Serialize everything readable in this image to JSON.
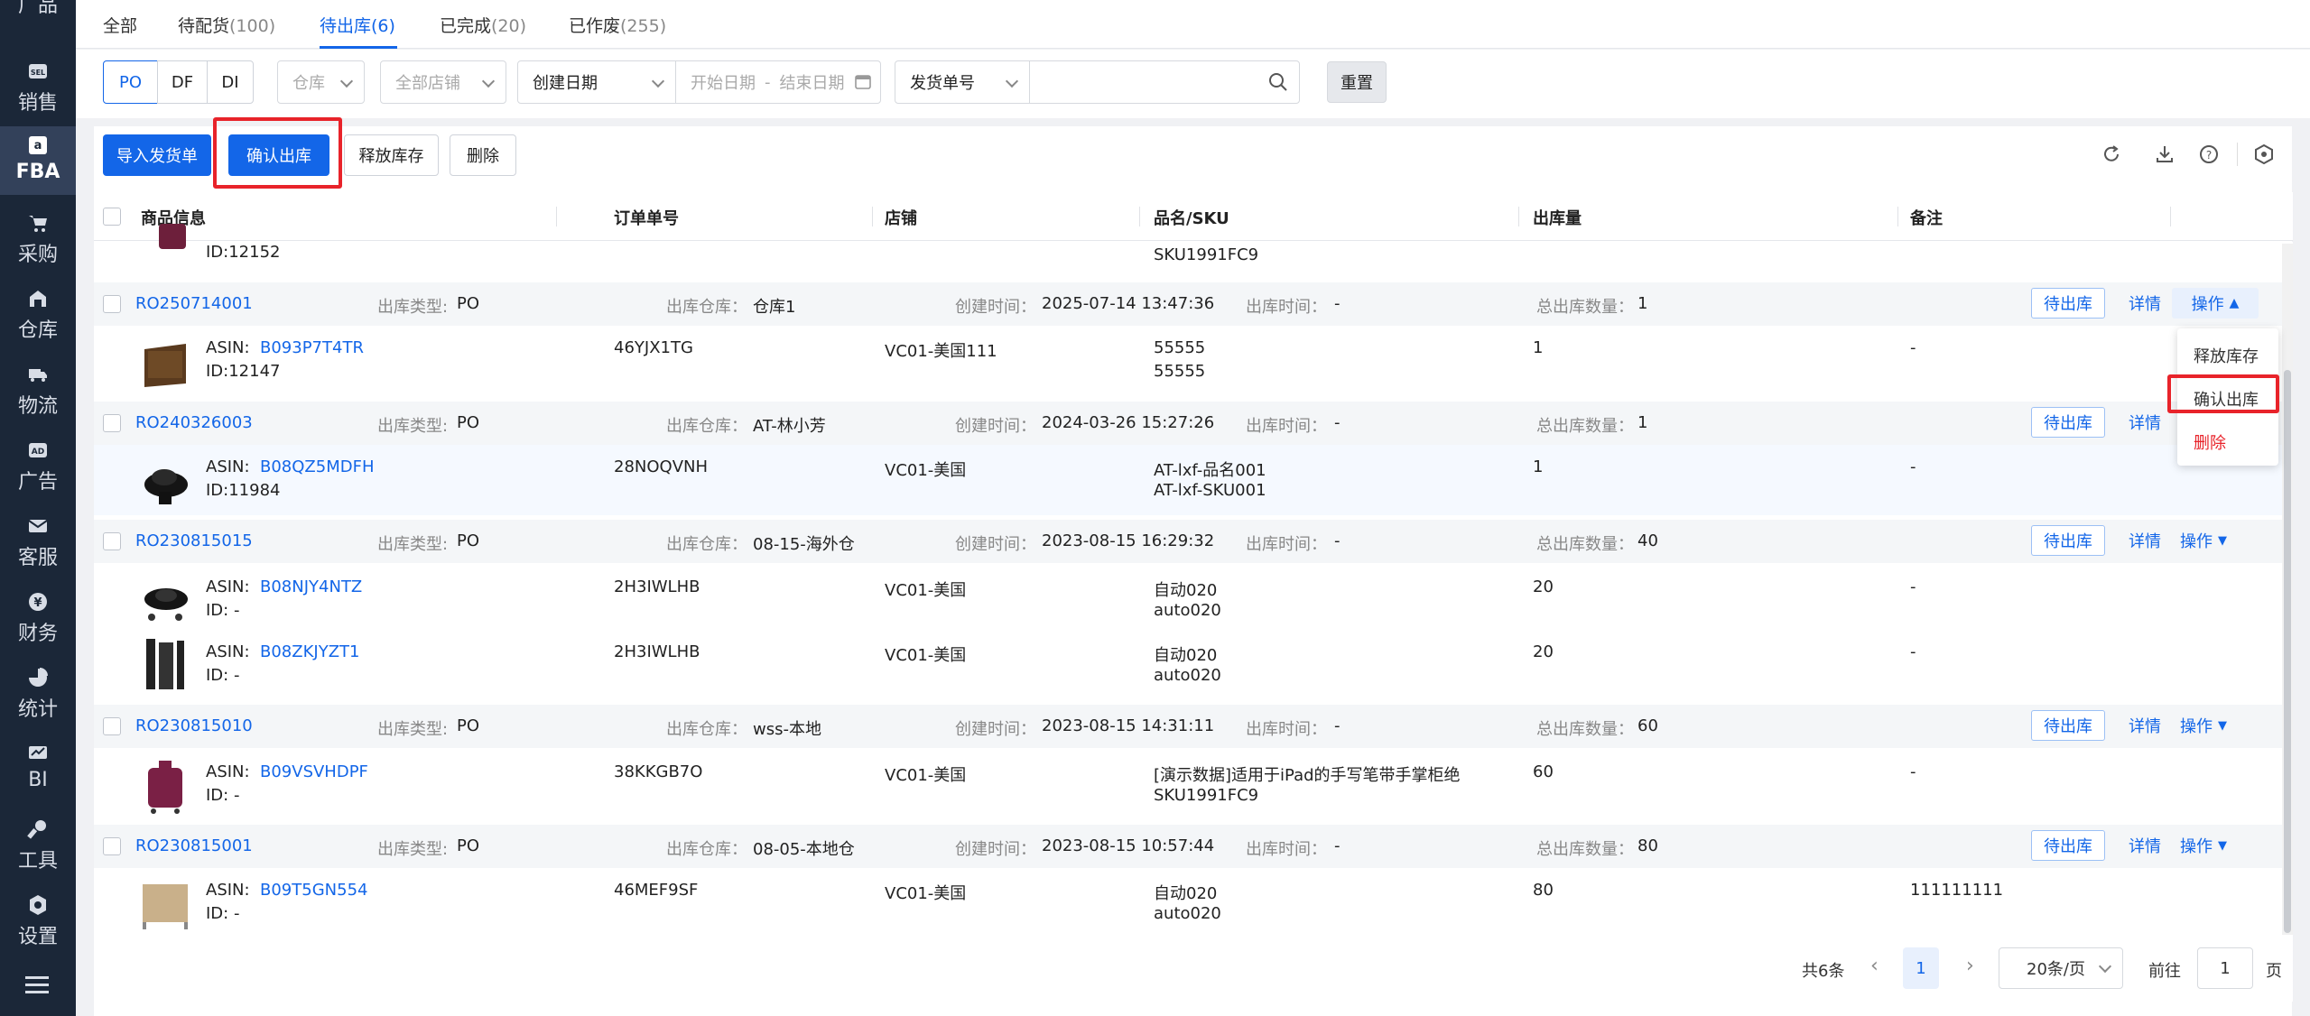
{
  "sidebar": {
    "items": [
      {
        "label": "广品",
        "icon": "product-icon"
      },
      {
        "label": "销售",
        "icon": "sel-icon"
      },
      {
        "label": "FBA",
        "icon": "amazon-icon",
        "active": true
      },
      {
        "label": "采购",
        "icon": "cart-icon"
      },
      {
        "label": "仓库",
        "icon": "warehouse-icon"
      },
      {
        "label": "物流",
        "icon": "truck-icon"
      },
      {
        "label": "广告",
        "icon": "ad-icon"
      },
      {
        "label": "客服",
        "icon": "mail-icon"
      },
      {
        "label": "财务",
        "icon": "money-icon"
      },
      {
        "label": "统计",
        "icon": "chart-icon"
      },
      {
        "label": "BI",
        "icon": "bi-icon"
      },
      {
        "label": "工具",
        "icon": "wrench-icon"
      },
      {
        "label": "设置",
        "icon": "gear-icon"
      }
    ],
    "menu_icon": "menu-icon"
  },
  "tabs": [
    {
      "label": "全部",
      "count": ""
    },
    {
      "label": "待配货",
      "count": "(100)"
    },
    {
      "label": "待出库",
      "count": "(6)",
      "active": true
    },
    {
      "label": "已完成",
      "count": "(20)"
    },
    {
      "label": "已作废",
      "count": "(255)"
    }
  ],
  "filters": {
    "type_segments": [
      "PO",
      "DF",
      "DI"
    ],
    "warehouse_placeholder": "仓库",
    "shop_placeholder": "全部店铺",
    "date_type": "创建日期",
    "date_start_placeholder": "开始日期",
    "date_sep": "-",
    "date_end_placeholder": "结束日期",
    "number_type": "发货单号",
    "search_value": "",
    "reset_label": "重置"
  },
  "actions": {
    "import_label": "导入发货单",
    "confirm_label": "确认出库",
    "release_label": "释放库存",
    "delete_label": "删除"
  },
  "table": {
    "headers": [
      "商品信息",
      "订单单号",
      "店铺",
      "品名/SKU",
      "出库量",
      "备注"
    ],
    "top_partial": {
      "id": "ID:12152",
      "sku_line2": "SKU1991FC9"
    },
    "orders": [
      {
        "no": "RO250714001",
        "type_key": "出库类型:",
        "type": "PO",
        "wh_key": "出库仓库：",
        "wh": "仓库1",
        "created_key": "创建时间：",
        "created": "2025-07-14 13:47:36",
        "out_key": "出库时间：",
        "out": "-",
        "total_key": "总出库数量：",
        "total": "1",
        "status": "待出库",
        "detail": "详情",
        "op": "操作",
        "items": [
          {
            "asin_key": "ASIN:",
            "asin": "B093P7T4TR",
            "id": "ID:12147",
            "order": "46YJX1TG",
            "shop": "VC01-美国111",
            "name": "55555",
            "sku": "55555",
            "qty": "1",
            "remark": "-"
          }
        ]
      },
      {
        "no": "RO240326003",
        "type_key": "出库类型:",
        "type": "PO",
        "wh_key": "出库仓库：",
        "wh": "AT-林小芳",
        "created_key": "创建时间：",
        "created": "2024-03-26 15:27:26",
        "out_key": "出库时间：",
        "out": "-",
        "total_key": "总出库数量：",
        "total": "1",
        "status": "待出库",
        "detail": "详情",
        "op": "操作",
        "items": [
          {
            "asin_key": "ASIN:",
            "asin": "B08QZ5MDFH",
            "id": "ID:11984",
            "order": "28NOQVNH",
            "shop": "VC01-美国",
            "name": "AT-lxf-品名001",
            "sku": "AT-lxf-SKU001",
            "qty": "1",
            "remark": "-"
          }
        ]
      },
      {
        "no": "RO230815015",
        "type_key": "出库类型:",
        "type": "PO",
        "wh_key": "出库仓库：",
        "wh": "08-15-海外仓",
        "created_key": "创建时间：",
        "created": "2023-08-15 16:29:32",
        "out_key": "出库时间：",
        "out": "-",
        "total_key": "总出库数量：",
        "total": "40",
        "status": "待出库",
        "detail": "详情",
        "op": "操作",
        "items": [
          {
            "asin_key": "ASIN:",
            "asin": "B08NJY4NTZ",
            "id": "ID: -",
            "order": "2H3IWLHB",
            "shop": "VC01-美国",
            "name": "自动020",
            "sku": "auto020",
            "qty": "20",
            "remark": "-"
          },
          {
            "asin_key": "ASIN:",
            "asin": "B08ZKJYZT1",
            "id": "ID: -",
            "order": "2H3IWLHB",
            "shop": "VC01-美国",
            "name": "自动020",
            "sku": "auto020",
            "qty": "20",
            "remark": "-"
          }
        ]
      },
      {
        "no": "RO230815010",
        "type_key": "出库类型:",
        "type": "PO",
        "wh_key": "出库仓库：",
        "wh": "wss-本地",
        "created_key": "创建时间：",
        "created": "2023-08-15 14:31:11",
        "out_key": "出库时间：",
        "out": "-",
        "total_key": "总出库数量：",
        "total": "60",
        "status": "待出库",
        "detail": "详情",
        "op": "操作",
        "items": [
          {
            "asin_key": "ASIN:",
            "asin": "B09VSVHDPF",
            "id": "ID: -",
            "order": "38KKGB7O",
            "shop": "VC01-美国",
            "name": "[演示数据]适用于iPad的手写笔带手掌柜绝",
            "sku": "SKU1991FC9",
            "qty": "60",
            "remark": "-"
          }
        ]
      },
      {
        "no": "RO230815001",
        "type_key": "出库类型:",
        "type": "PO",
        "wh_key": "出库仓库：",
        "wh": "08-05-本地仓",
        "created_key": "创建时间：",
        "created": "2023-08-15 10:57:44",
        "out_key": "出库时间：",
        "out": "-",
        "total_key": "总出库数量：",
        "total": "80",
        "status": "待出库",
        "detail": "详情",
        "op": "操作",
        "items": [
          {
            "asin_key": "ASIN:",
            "asin": "B09T5GN554",
            "id": "ID: -",
            "order": "46MEF9SF",
            "shop": "VC01-美国",
            "name": "自动020",
            "sku": "auto020",
            "qty": "80",
            "remark": "111111111"
          }
        ]
      }
    ]
  },
  "dropdown": {
    "items": [
      "释放库存",
      "确认出库",
      "删除"
    ]
  },
  "pager": {
    "total": "共6条",
    "current_page": "1",
    "page_size": "20条/页",
    "goto_label": "前往",
    "goto_value": "1",
    "page_unit": "页"
  },
  "colors": {
    "primary": "#1366e8",
    "danger": "#e8232a",
    "sidebar": "#1b2738"
  }
}
